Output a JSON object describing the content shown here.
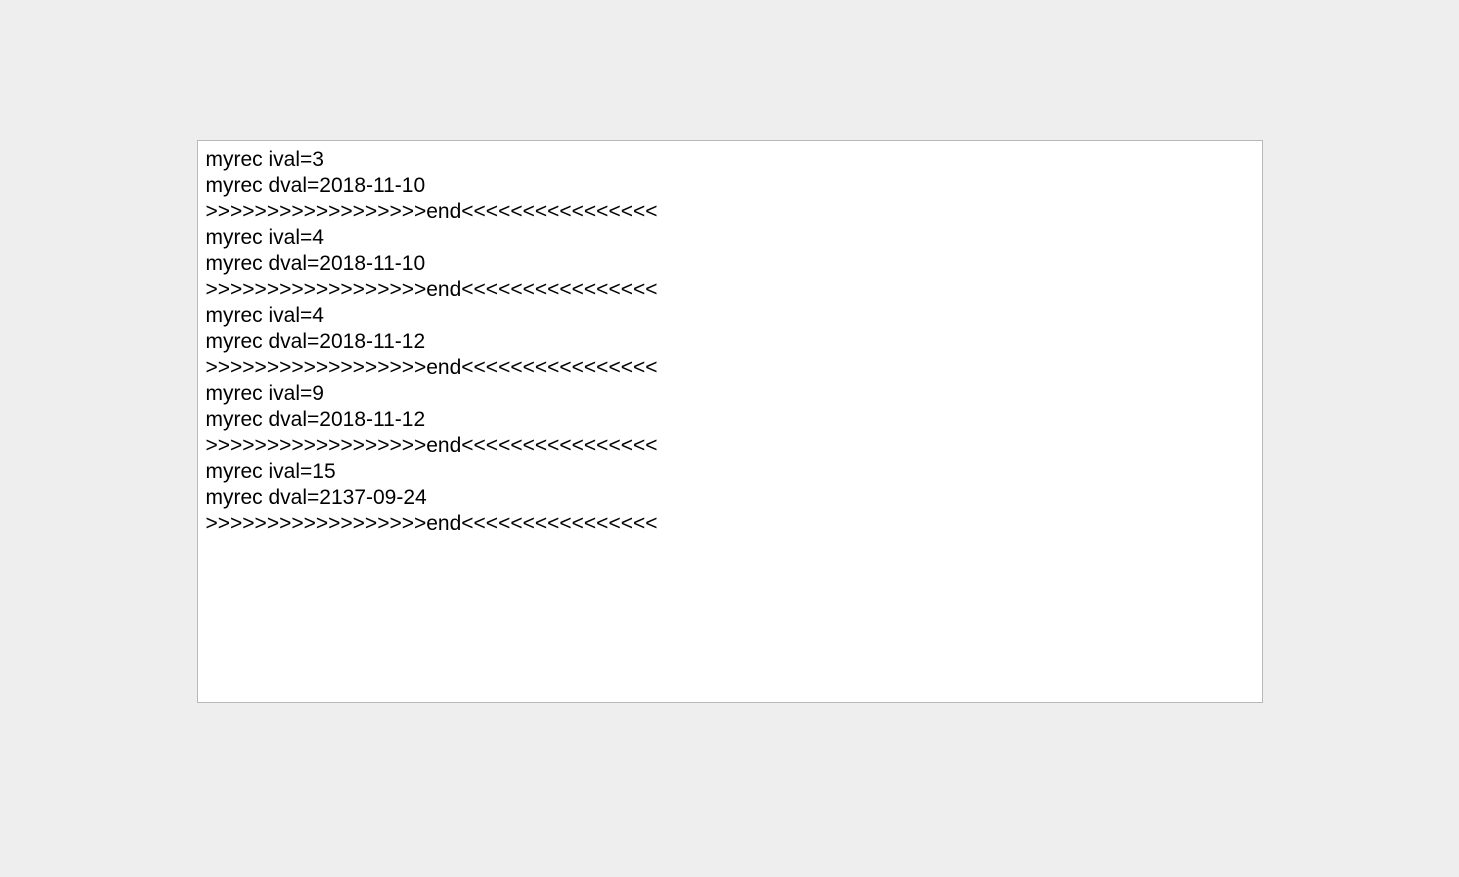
{
  "output": {
    "records": [
      {
        "ival": 3,
        "dval": "2018-11-10"
      },
      {
        "ival": 4,
        "dval": "2018-11-10"
      },
      {
        "ival": 4,
        "dval": "2018-11-12"
      },
      {
        "ival": 9,
        "dval": "2018-11-12"
      },
      {
        "ival": 15,
        "dval": "2137-09-24"
      }
    ],
    "separator": ">>>>>>>>>>>>>>>>>>end<<<<<<<<<<<<<<<<",
    "lines": [
      "myrec ival=3",
      "myrec dval=2018-11-10",
      ">>>>>>>>>>>>>>>>>>end<<<<<<<<<<<<<<<<",
      "myrec ival=4",
      "myrec dval=2018-11-10",
      ">>>>>>>>>>>>>>>>>>end<<<<<<<<<<<<<<<<",
      "myrec ival=4",
      "myrec dval=2018-11-12",
      ">>>>>>>>>>>>>>>>>>end<<<<<<<<<<<<<<<<",
      "myrec ival=9",
      "myrec dval=2018-11-12",
      ">>>>>>>>>>>>>>>>>>end<<<<<<<<<<<<<<<<",
      "myrec ival=15",
      "myrec dval=2137-09-24",
      ">>>>>>>>>>>>>>>>>>end<<<<<<<<<<<<<<<<"
    ]
  }
}
